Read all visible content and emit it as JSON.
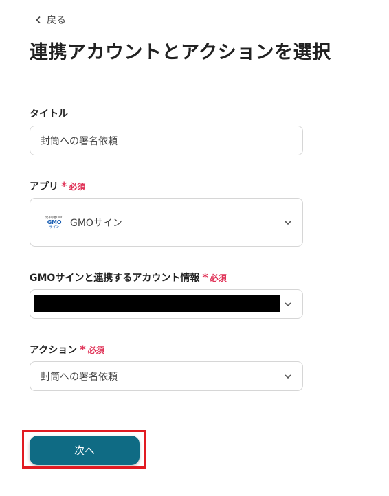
{
  "nav": {
    "back_label": "戻る"
  },
  "page": {
    "title": "連携アカウントとアクションを選択"
  },
  "required_label": "必須",
  "required_marker": "*",
  "form": {
    "title_field": {
      "label": "タイトル",
      "value": "封筒への署名依頼"
    },
    "app_field": {
      "label": "アプリ",
      "value": "GMOサイン",
      "logo": {
        "top_text": "電子印鑑GMO",
        "brand": "GMO",
        "sub": "サイン"
      }
    },
    "account_field": {
      "label": "GMOサインと連携するアカウント情報",
      "value_redacted": true
    },
    "action_field": {
      "label": "アクション",
      "value": "封筒への署名依頼"
    }
  },
  "next_button": {
    "label": "次へ"
  },
  "colors": {
    "primary_button": "#0f6b84",
    "required": "#e0365a",
    "highlight_box": "#e11b22"
  }
}
